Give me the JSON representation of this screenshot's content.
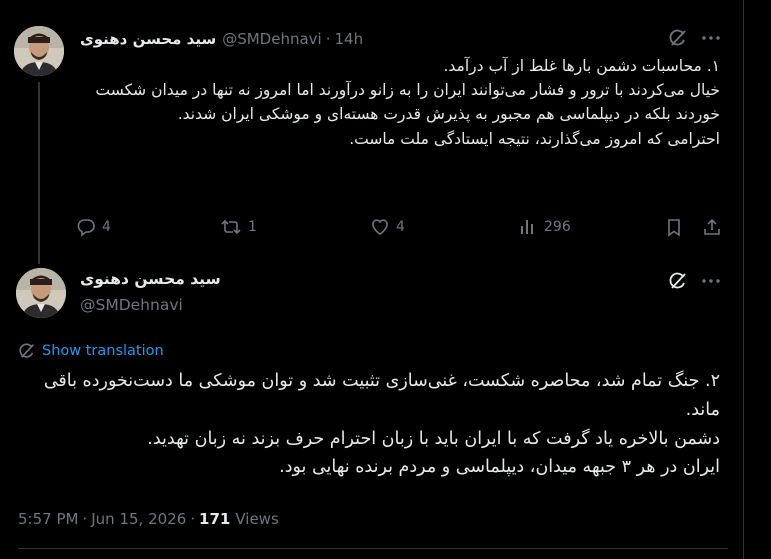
{
  "colors": {
    "background": "#000000",
    "text": "#e7e9ea",
    "muted": "#71767b",
    "link": "#1d9bf0",
    "divider": "#2f3336"
  },
  "tweet1": {
    "author_name": "سید محسن دهنوی",
    "handle": "@SMDehnavi",
    "separator": "·",
    "time": "14h",
    "text": "۱. محاسبات دشمن بارها غلط از آب درآمد.\nخیال می‌کردند با ترور و فشار می‌توانند ایران را به زانو درآورند اما امروز نه تنها در میدان شکست خوردند بلکه در دیپلماسی هم مجبور به پذیرش قدرت هسته‌ای و موشکی ایران شدند.\nاحترامی که امروز می‌گذارند، نتیجه ایستادگی ملت ماست.",
    "replies": "4",
    "reposts": "1",
    "likes": "4",
    "views": "296",
    "icons": [
      "grok-icon",
      "more-icon",
      "reply-icon",
      "repost-icon",
      "like-icon",
      "views-icon",
      "bookmark-icon",
      "share-icon"
    ]
  },
  "tweet2": {
    "author_name": "سید محسن دهنوی",
    "handle": "@SMDehnavi",
    "show_translation": "Show translation",
    "text": "۲. جنگ تمام شد، محاصره شکست، غنی‌سازی تثبیت شد و توان موشکی ما دست‌نخورده باقی ماند.\nدشمن بالاخره یاد گرفت که با ایران باید با زبان احترام حرف بزند نه زبان تهدید.\nایران در هر ۳ جبهه میدان، دیپلماسی و مردم برنده نهایی بود.",
    "time": "5:57 PM",
    "dot": "·",
    "date": "Jun 15, 2026",
    "views_count": "171",
    "views_label": "Views"
  }
}
